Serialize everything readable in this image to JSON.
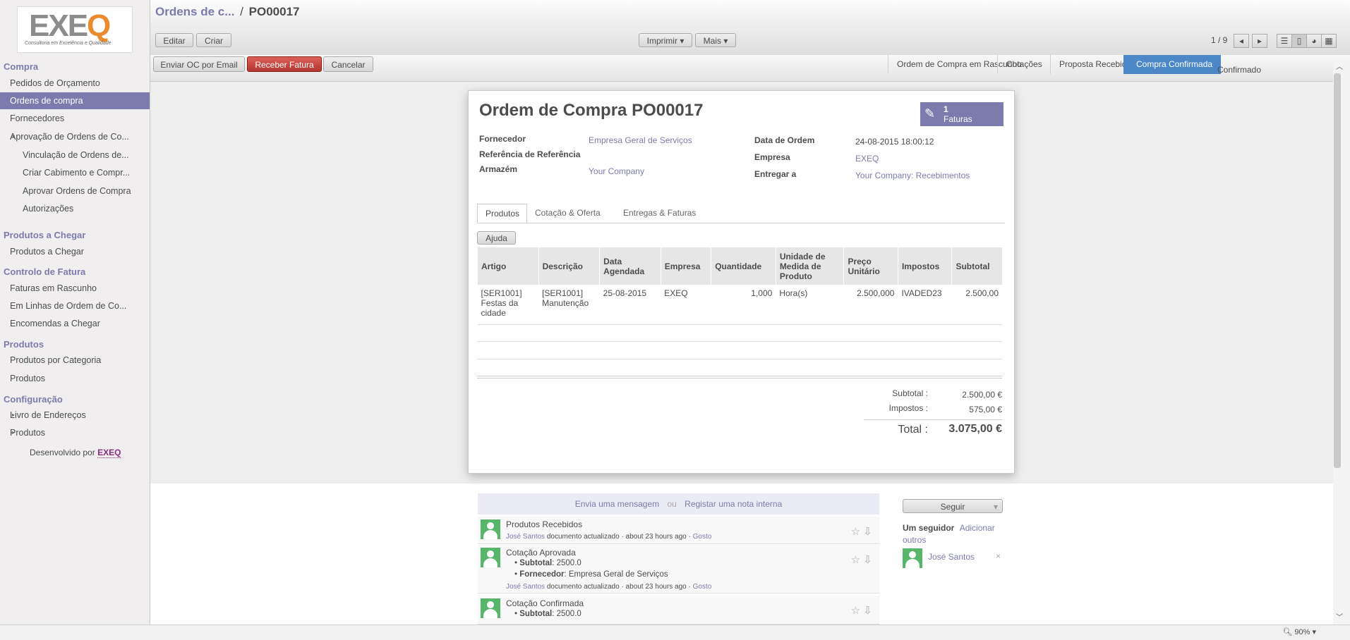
{
  "sidebar": {
    "logo_text": "EXEQ",
    "logo_tagline": "Consultoria em Excelência e Qualidade",
    "sections": [
      {
        "label": "Compra"
      },
      {
        "label": "Produtos a Chegar"
      },
      {
        "label": "Controlo de Fatura"
      },
      {
        "label": "Produtos"
      },
      {
        "label": "Configuração"
      }
    ],
    "items": [
      "Pedidos de Orçamento",
      "Ordens de compra",
      "Fornecedores",
      "Aprovação de Ordens de Co...",
      "Vinculação de Ordens de...",
      "Criar Cabimento e Compr...",
      "Aprovar Ordens de Compra",
      "Autorizações",
      "Produtos a Chegar",
      "Faturas em Rascunho",
      "Em Linhas de Ordem de Co...",
      "Encomendas a Chegar",
      "Produtos por Categoria",
      "Produtos",
      "Livro de Endereços",
      "Produtos"
    ],
    "developed_by": "Desenvolvido por",
    "developed_by_link": "EXEQ"
  },
  "header": {
    "breadcrumb_parent": "Ordens de c...",
    "breadcrumb_sep": "/",
    "breadcrumb_current": "PO00017",
    "edit": "Editar",
    "create": "Criar",
    "print": "Imprimir",
    "more": "Mais",
    "pager": "1 / 9"
  },
  "actions": {
    "email": "Enviar OC por Email",
    "receive_invoice": "Receber Fatura",
    "cancel": "Cancelar"
  },
  "statusbar": {
    "steps": [
      "Ordem de Compra em Rascunho",
      "Cotações",
      "Proposta Recebida",
      "Compra Confirmada",
      "Confirmado"
    ],
    "current_index": 3
  },
  "form": {
    "title": "Ordem de Compra",
    "number": "PO00017",
    "invoice_count": "1",
    "invoice_label": "Faturas",
    "fields_left": [
      {
        "label": "Fornecedor",
        "value": "Empresa Geral de Serviços"
      },
      {
        "label": "Referência de Referência",
        "value": ""
      },
      {
        "label": "Armazém",
        "value": "Your Company"
      }
    ],
    "fields_right": [
      {
        "label": "Data de Ordem",
        "value": "24-08-2015 18:00:12"
      },
      {
        "label": "Empresa",
        "value": "EXEQ"
      },
      {
        "label": "Entregar a",
        "value": "Your Company: Recebimentos"
      }
    ],
    "tabs": [
      "Produtos",
      "Cotação & Oferta",
      "Entregas & Faturas"
    ],
    "help_button": "Ajuda",
    "columns": [
      "Artigo",
      "Descrição",
      "Data Agendada",
      "Empresa",
      "Quantidade",
      "Unidade de Medida de Produto",
      "Preço Unitário",
      "Impostos",
      "Subtotal"
    ],
    "rows": [
      [
        "[SER1001] Festas da cidade",
        "[SER1001] Manutenção",
        "25-08-2015",
        "EXEQ",
        "1,000",
        "Hora(s)",
        "2.500,000",
        "IVADED23",
        "2.500,00"
      ]
    ],
    "totals": {
      "subtotal_label": "Subtotal :",
      "subtotal": "2.500,00 €",
      "taxes_label": "Impostos :",
      "taxes": "575,00 €",
      "total_label": "Total :",
      "total": "3.075,00 €"
    }
  },
  "chatter": {
    "send_message": "Envia uma mensagem",
    "or": "ou",
    "log_note": "Registar uma nota interna",
    "messages": [
      {
        "title": "Produtos Recebidos",
        "author": "José Santos",
        "meta": "documento actualizado · about 23 hours ago ·",
        "like": "Gosto",
        "bullets": []
      },
      {
        "title": "Cotação Aprovada",
        "author": "José Santos",
        "meta": "documento actualizado · about 23 hours ago ·",
        "like": "Gosto",
        "bullets": [
          {
            "k": "Subtotal",
            "v": ": 2500.0"
          },
          {
            "k": "Fornecedor",
            "v": ": Empresa Geral de Serviços"
          }
        ]
      },
      {
        "title": "Cotação Confirmada",
        "author": "",
        "meta": "",
        "like": "",
        "bullets": [
          {
            "k": "Subtotal",
            "v": ": 2500.0"
          }
        ]
      }
    ],
    "follow_button": "Seguir",
    "followers_label": "Um seguidor",
    "add_others": "Adicionar outros",
    "follower_name": "José Santos"
  },
  "statusline": {
    "zoom": "90%"
  },
  "colors": {
    "accent": "#7c7bad",
    "current_step": "#4c87c8",
    "danger": "#c0392b"
  }
}
